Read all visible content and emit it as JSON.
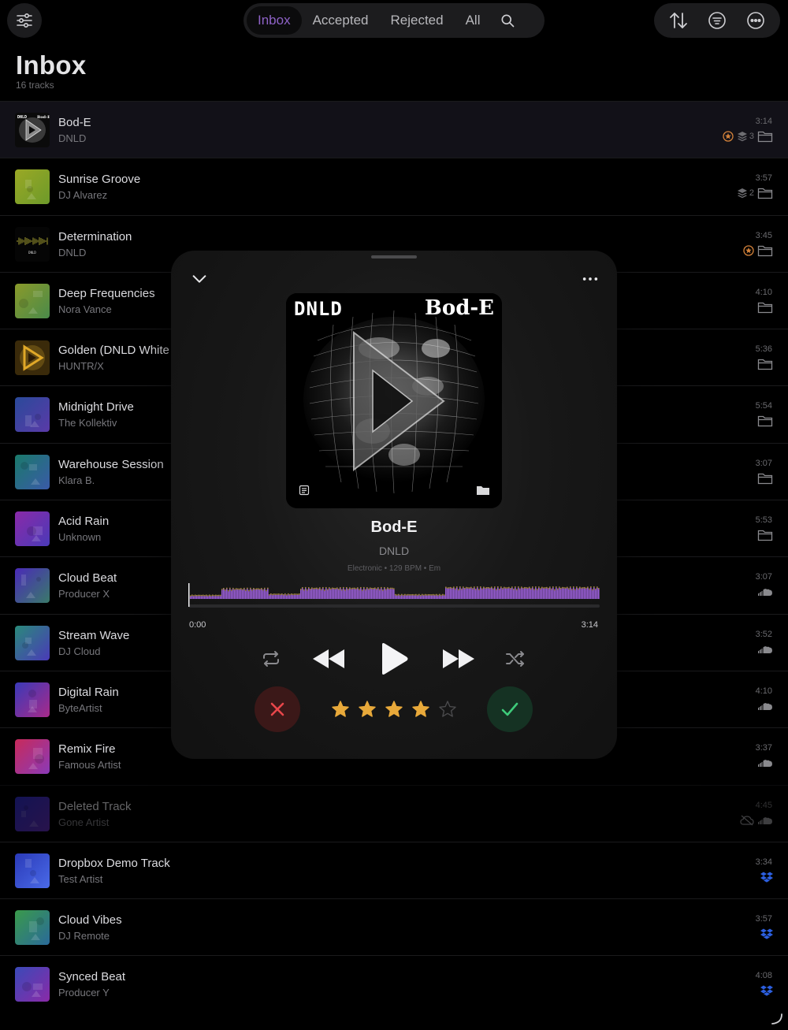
{
  "topbar": {
    "tabs": [
      {
        "label": "Inbox",
        "active": true
      },
      {
        "label": "Accepted",
        "active": false
      },
      {
        "label": "Rejected",
        "active": false
      },
      {
        "label": "All",
        "active": false
      }
    ],
    "icons": [
      "sliders-icon",
      "search-icon",
      "sort-icon",
      "filter-lines-icon",
      "more-circle-icon"
    ],
    "accent": "#8e62c6"
  },
  "page": {
    "title": "Inbox",
    "subtitle": "16 tracks"
  },
  "tracks": [
    {
      "title": "Bod-E",
      "artist": "DNLD",
      "duration": "3:14",
      "badges": [
        "star-badge-icon",
        "stack-icon",
        "folder-icon"
      ],
      "stack_count": "3",
      "selected": true
    },
    {
      "title": "Sunrise Groove",
      "artist": "DJ Alvarez",
      "duration": "3:57",
      "badges": [
        "stack-icon",
        "folder-icon"
      ],
      "stack_count": "2"
    },
    {
      "title": "Determination",
      "artist": "DNLD",
      "duration": "3:45",
      "badges": [
        "star-badge-icon",
        "folder-icon"
      ]
    },
    {
      "title": "Deep Frequencies",
      "artist": "Nora Vance",
      "duration": "4:10",
      "badges": [
        "folder-icon"
      ]
    },
    {
      "title": "Golden (DNLD White L",
      "artist": "HUNTR/X",
      "duration": "5:36",
      "badges": [
        "folder-icon"
      ]
    },
    {
      "title": "Midnight Drive",
      "artist": "The Kollektiv",
      "duration": "5:54",
      "badges": [
        "folder-icon"
      ]
    },
    {
      "title": "Warehouse Session",
      "artist": "Klara B.",
      "duration": "3:07",
      "badges": [
        "folder-icon"
      ]
    },
    {
      "title": "Acid Rain",
      "artist": "Unknown",
      "duration": "5:53",
      "badges": [
        "folder-icon"
      ]
    },
    {
      "title": "Cloud Beat",
      "artist": "Producer X",
      "duration": "3:07",
      "badges": [
        "soundcloud-icon"
      ]
    },
    {
      "title": "Stream Wave",
      "artist": "DJ Cloud",
      "duration": "3:52",
      "badges": [
        "soundcloud-icon"
      ]
    },
    {
      "title": "Digital Rain",
      "artist": "ByteArtist",
      "duration": "4:10",
      "badges": [
        "soundcloud-icon"
      ]
    },
    {
      "title": "Remix Fire",
      "artist": "Famous Artist",
      "duration": "3:37",
      "badges": [
        "soundcloud-icon"
      ]
    },
    {
      "title": "Deleted Track",
      "artist": "Gone Artist",
      "duration": "4:45",
      "badges": [
        "cloud-off-icon",
        "soundcloud-icon"
      ],
      "deleted": true
    },
    {
      "title": "Dropbox Demo Track",
      "artist": "Test Artist",
      "duration": "3:34",
      "badges": [
        "dropbox-icon"
      ]
    },
    {
      "title": "Cloud Vibes",
      "artist": "DJ Remote",
      "duration": "3:57",
      "badges": [
        "dropbox-icon"
      ]
    },
    {
      "title": "Synced Beat",
      "artist": "Producer Y",
      "duration": "4:08",
      "badges": [
        "dropbox-icon"
      ]
    }
  ],
  "thumb_colors": [
    [
      "#111111",
      "#333333"
    ],
    [
      "#9aa825",
      "#6d9a2a"
    ],
    [
      "#0a0a0a",
      "#2a2a10"
    ],
    [
      "#8a9a2a",
      "#4a8a4a"
    ],
    [
      "#3a2a0a",
      "#8a6a1a"
    ],
    [
      "#2a4a9a",
      "#5a3aa8"
    ],
    [
      "#1a7a6a",
      "#3a5aa8"
    ],
    [
      "#8a2aa8",
      "#4a3ab8"
    ],
    [
      "#4a2ab8",
      "#3a7a6a"
    ],
    [
      "#2a8a7a",
      "#4a3ab8"
    ],
    [
      "#3a3ab8",
      "#a82a8a"
    ],
    [
      "#c82a5a",
      "#8a3ab8"
    ],
    [
      "#2a2ab8",
      "#5a2aa8"
    ],
    [
      "#2a3ab8",
      "#4a6ae8"
    ],
    [
      "#3a9a4a",
      "#2a6a9a"
    ],
    [
      "#3a4ab8",
      "#8a2aa8"
    ]
  ],
  "player": {
    "title": "Bod-E",
    "artist": "DNLD",
    "meta": "Electronic • 129 BPM • Em",
    "artwork_logo": "DNLD",
    "artwork_title": "Bod-E",
    "time_elapsed": "0:00",
    "time_total": "3:14",
    "rating": 4,
    "max_rating": 5,
    "progress": 0.0,
    "colors": {
      "waveform": "#9b5fd8",
      "star": "#e8a93a",
      "reject": "#e8464a",
      "accept": "#3ecb7a"
    }
  }
}
